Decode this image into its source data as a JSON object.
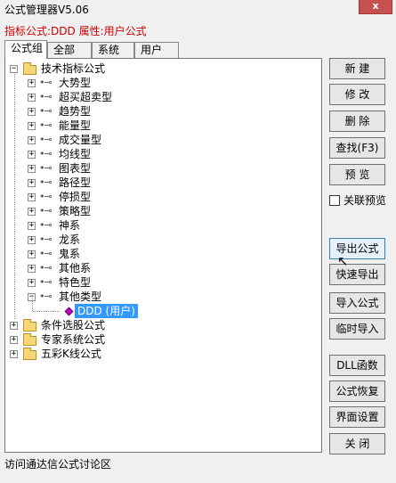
{
  "window": {
    "title": "公式管理器V5.06",
    "close_label": "x"
  },
  "info_line": "指标公式:DDD 属性:用户公式",
  "tabs": [
    "公式组",
    "全部",
    "系统",
    "用户"
  ],
  "tree": {
    "root": "技术指标公式",
    "children": [
      "大势型",
      "超买超卖型",
      "趋势型",
      "能量型",
      "成交量型",
      "均线型",
      "图表型",
      "路径型",
      "停损型",
      "策略型",
      "神系",
      "龙系",
      "鬼系",
      "其他系",
      "特色型",
      "其他类型"
    ],
    "leaf": "DDD  (用户)",
    "top_groups": [
      "条件选股公式",
      "专家系统公式",
      "五彩K线公式"
    ]
  },
  "buttons": {
    "new": "新 建",
    "edit": "修 改",
    "delete": "删 除",
    "find": "查找(F3)",
    "preview": "预 览",
    "export": "导出公式",
    "quick_export": "快速导出",
    "import": "导入公式",
    "temp_import": "临时导入",
    "dll": "DLL函数",
    "restore": "公式恢复",
    "ui_settings": "界面设置",
    "close": "关 闭"
  },
  "linked_preview": "关联预览",
  "status": "访问通达信公式讨论区"
}
